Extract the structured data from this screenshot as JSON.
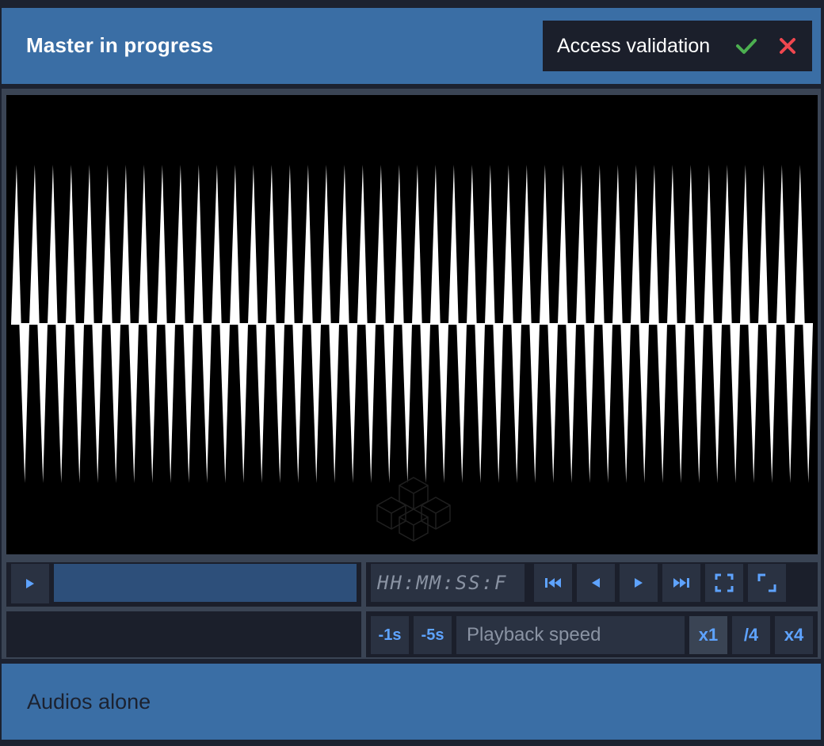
{
  "header": {
    "title": "Master in progress",
    "access": {
      "label": "Access validation",
      "accept_icon": "check-icon",
      "reject_icon": "close-icon",
      "accept_color": "#4caf50",
      "reject_color": "#f0474f"
    }
  },
  "viewer": {
    "content": "waveform",
    "colors": {
      "background": "#000000",
      "waveform": "#ffffff"
    },
    "watermark_icon": "isometric-cubes-logo"
  },
  "controls": {
    "play_icon": "play-icon",
    "timecode_placeholder": "HH:MM:SS:F",
    "transport_icons": [
      "skip-start-icon",
      "step-back-icon",
      "step-forward-icon",
      "skip-end-icon"
    ],
    "fullscreen_icon": "fullscreen-icon",
    "resize_icon": "resize-icon",
    "seek_back_1": "-1s",
    "seek_back_5": "-5s",
    "playback_speed_placeholder": "Playback speed",
    "speeds": [
      "x1",
      "/4",
      "x4"
    ],
    "active_speed": "x1",
    "accent_color": "#5ea3ff"
  },
  "footer": {
    "label": "Audios alone"
  }
}
